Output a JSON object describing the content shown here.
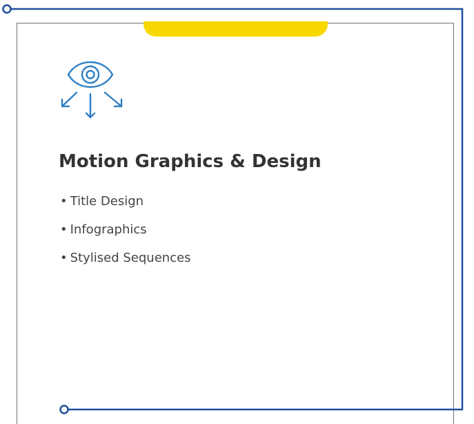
{
  "card": {
    "icon": "eye-with-arrows-icon",
    "title": "Motion Graphics & Design",
    "features": [
      "Title Design",
      "Infographics",
      "Stylised Sequences"
    ],
    "bullet": "•"
  },
  "colors": {
    "accent_tab": "#f7d800",
    "frame_line": "#1f4f9a",
    "icon": "#2f7fc4",
    "title": "#333333",
    "text": "#444444",
    "card_border": "#6f6f6f"
  }
}
